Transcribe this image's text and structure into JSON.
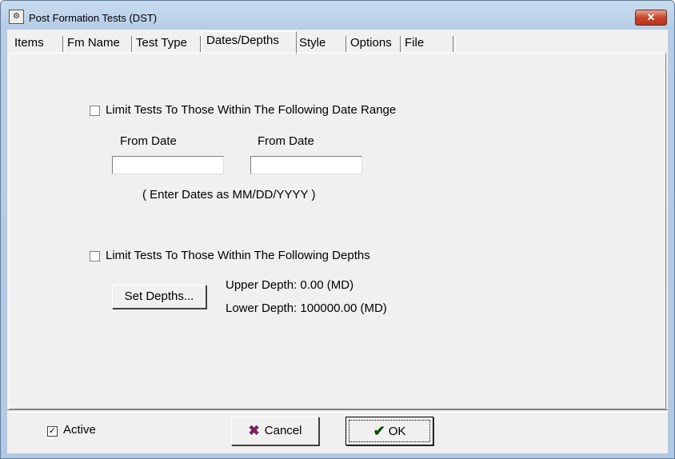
{
  "window": {
    "title": "Post Formation Tests (DST)",
    "icon": "app-icon",
    "close_label": "✕"
  },
  "tabs": [
    {
      "label": "Items"
    },
    {
      "label": "Fm Name"
    },
    {
      "label": "Test Type"
    },
    {
      "label": "Dates/Depths",
      "selected": true
    },
    {
      "label": "Style"
    },
    {
      "label": "Options"
    },
    {
      "label": "File"
    }
  ],
  "dates": {
    "limit_label": "Limit Tests To Those Within The Following Date Range",
    "limit_checked": false,
    "from_label_1": "From Date",
    "from_label_2": "From Date",
    "from_value_1": "",
    "from_value_2": "",
    "hint": "( Enter Dates as MM/DD/YYYY )"
  },
  "depths": {
    "limit_label": "Limit Tests To Those Within The Following Depths",
    "limit_checked": false,
    "set_button": "Set Depths...",
    "upper": "Upper Depth: 0.00 (MD)",
    "lower": "Lower Depth: 100000.00 (MD)"
  },
  "footer": {
    "active_label": "Active",
    "active_checked": true,
    "cancel_label": "Cancel",
    "ok_label": "OK"
  },
  "colors": {
    "title_bar": "#c9dcef",
    "close_button": "#c9452c",
    "cancel_icon": "#7a1f5a",
    "ok_icon": "#0b4f0b"
  }
}
